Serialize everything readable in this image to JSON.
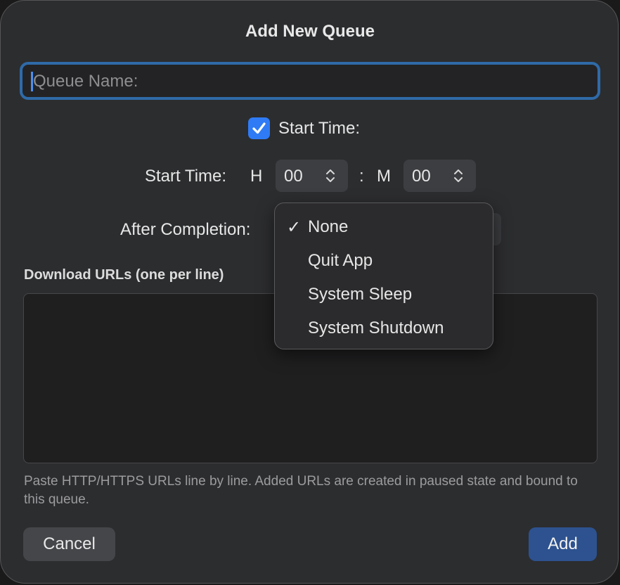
{
  "dialog": {
    "title": "Add New Queue"
  },
  "queue_name": {
    "value": "",
    "placeholder": "Queue Name:"
  },
  "start_time_toggle": {
    "label": "Start Time:",
    "checked": true
  },
  "start_time": {
    "label": "Start Time:",
    "hour_label": "H",
    "separator": ":",
    "minute_label": "M",
    "hour_value": "00",
    "minute_value": "00"
  },
  "after_completion": {
    "label": "After Completion:",
    "selected": "None",
    "options": [
      {
        "label": "None",
        "checkmark": "✓"
      },
      {
        "label": "Quit App",
        "checkmark": ""
      },
      {
        "label": "System Sleep",
        "checkmark": ""
      },
      {
        "label": "System Shutdown",
        "checkmark": ""
      }
    ]
  },
  "download_urls": {
    "label": "Download URLs (one per line)",
    "value": "",
    "help": "Paste HTTP/HTTPS URLs line by line. Added URLs are created in paused state and bound to this queue."
  },
  "buttons": {
    "cancel": "Cancel",
    "add": "Add"
  },
  "colors": {
    "accent": "#2f7bf5",
    "primary_button": "#2d528f",
    "focus_ring": "#2f6aa8"
  },
  "icons": {
    "checkbox": "checkmark-icon",
    "stepper": "up-down-chevron-icon"
  }
}
